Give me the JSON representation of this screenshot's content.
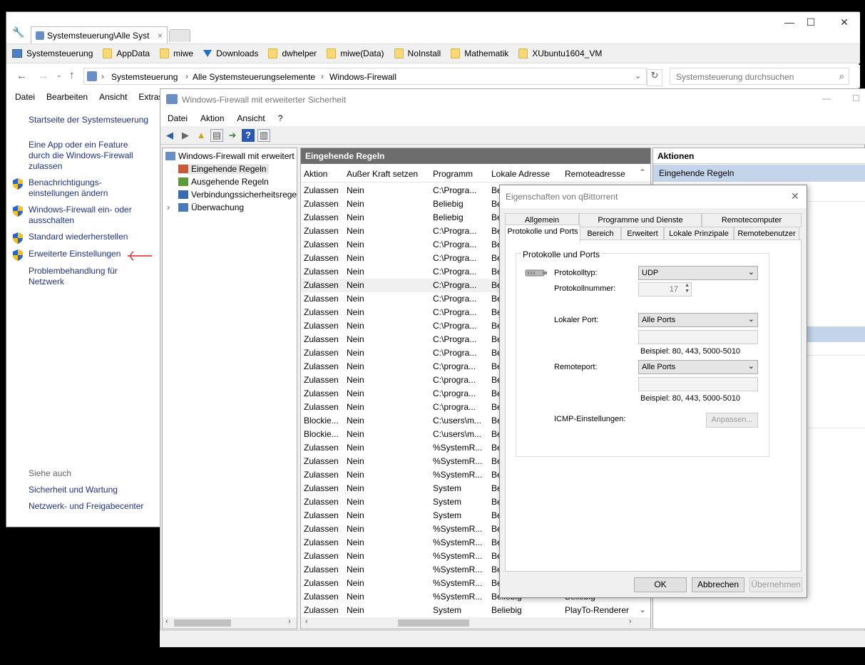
{
  "cp": {
    "tab_title": "Systemsteuerung\\Alle Syst",
    "favorites": [
      "Systemsteuerung",
      "AppData",
      "miwe",
      "Downloads",
      "dwhelper",
      "miwe(Data)",
      "NoInstall",
      "Mathematik",
      "XUbuntu1604_VM"
    ],
    "breadcrumb": [
      "Systemsteuerung",
      "Alle Systemsteuerungselemente",
      "Windows-Firewall"
    ],
    "search_placeholder": "Systemsteuerung durchsuchen",
    "menu": [
      "Datei",
      "Bearbeiten",
      "Ansicht",
      "Extras"
    ],
    "links": {
      "home": "Startseite der Systemsteuerung",
      "allow_app": "Eine App oder ein Feature durch die Windows-Firewall zulassen",
      "notify": "Benachrichtigungs-einstellungen ändern",
      "onoff": "Windows-Firewall ein- oder ausschalten",
      "restore": "Standard wiederherstellen",
      "advanced": "Erweiterte Einstellungen",
      "troubleshoot": "Problembehandlung für Netzwerk"
    },
    "see_also": "Siehe auch",
    "see_also_links": [
      "Sicherheit und Wartung",
      "Netzwerk- und Freigabecenter"
    ]
  },
  "fw": {
    "title": "Windows-Firewall mit erweiterter Sicherheit",
    "menu": [
      "Datei",
      "Aktion",
      "Ansicht",
      "?"
    ],
    "tree": {
      "root": "Windows-Firewall mit erweitert",
      "inbound": "Eingehende Regeln",
      "outbound": "Ausgehende Regeln",
      "connsec": "Verbindungssicherheitsrege",
      "monitor": "Überwachung"
    },
    "list_title": "Eingehende Regeln",
    "columns": [
      "Aktion",
      "Außer Kraft setzen",
      "Programm",
      "Lokale Adresse",
      "Remoteadresse"
    ],
    "rows": [
      [
        "Zulassen",
        "Nein",
        "C:\\Progra...",
        "Be",
        ""
      ],
      [
        "Zulassen",
        "Nein",
        "Beliebig",
        "Be",
        ""
      ],
      [
        "Zulassen",
        "Nein",
        "Beliebig",
        "Be",
        ""
      ],
      [
        "Zulassen",
        "Nein",
        "C:\\Progra...",
        "Be",
        ""
      ],
      [
        "Zulassen",
        "Nein",
        "C:\\Progra...",
        "Be",
        ""
      ],
      [
        "Zulassen",
        "Nein",
        "C:\\Progra...",
        "Be",
        ""
      ],
      [
        "Zulassen",
        "Nein",
        "C:\\Progra...",
        "Be",
        ""
      ],
      [
        "Zulassen",
        "Nein",
        "C:\\Progra...",
        "Be",
        ""
      ],
      [
        "Zulassen",
        "Nein",
        "C:\\Progra...",
        "Be",
        ""
      ],
      [
        "Zulassen",
        "Nein",
        "C:\\Progra...",
        "Be",
        ""
      ],
      [
        "Zulassen",
        "Nein",
        "C:\\Progra...",
        "Be",
        ""
      ],
      [
        "Zulassen",
        "Nein",
        "C:\\Progra...",
        "Be",
        ""
      ],
      [
        "Zulassen",
        "Nein",
        "C:\\Progra...",
        "Be",
        ""
      ],
      [
        "Zulassen",
        "Nein",
        "C:\\progra...",
        "Be",
        ""
      ],
      [
        "Zulassen",
        "Nein",
        "C:\\progra...",
        "Be",
        ""
      ],
      [
        "Zulassen",
        "Nein",
        "C:\\progra...",
        "Be",
        ""
      ],
      [
        "Zulassen",
        "Nein",
        "C:\\progra...",
        "Be",
        ""
      ],
      [
        "Blockie...",
        "Nein",
        "C:\\users\\m...",
        "Be",
        ""
      ],
      [
        "Blockie...",
        "Nein",
        "C:\\users\\m...",
        "Be",
        ""
      ],
      [
        "Zulassen",
        "Nein",
        "%SystemR...",
        "Be",
        ""
      ],
      [
        "Zulassen",
        "Nein",
        "%SystemR...",
        "Be",
        ""
      ],
      [
        "Zulassen",
        "Nein",
        "%SystemR...",
        "Be",
        ""
      ],
      [
        "Zulassen",
        "Nein",
        "System",
        "Be",
        ""
      ],
      [
        "Zulassen",
        "Nein",
        "System",
        "Be",
        ""
      ],
      [
        "Zulassen",
        "Nein",
        "System",
        "Be",
        ""
      ],
      [
        "Zulassen",
        "Nein",
        "%SystemR...",
        "Be",
        ""
      ],
      [
        "Zulassen",
        "Nein",
        "%SystemR...",
        "Be",
        ""
      ],
      [
        "Zulassen",
        "Nein",
        "%SystemR...",
        "Be",
        ""
      ],
      [
        "Zulassen",
        "Nein",
        "%SystemR...",
        "Be",
        ""
      ],
      [
        "Zulassen",
        "Nein",
        "%SystemR...",
        "Be",
        ""
      ],
      [
        "Zulassen",
        "Nein",
        "%SystemR...",
        "Beliebig",
        "Beliebig"
      ],
      [
        "Zulassen",
        "Nein",
        "System",
        "Beliebig",
        "PlayTo-Renderer"
      ]
    ],
    "actions_title": "Aktionen",
    "actions_section": "Eingehende Regeln"
  },
  "dlg": {
    "title": "Eigenschaften von qBittorrent",
    "tabs_row1": [
      "Allgemein",
      "Programme und Dienste",
      "Remotecomputer"
    ],
    "tabs_row2": [
      "Protokolle und Ports",
      "Bereich",
      "Erweitert",
      "Lokale Prinzipale",
      "Remotebenutzer"
    ],
    "group": "Protokolle und Ports",
    "proto_type_label": "Protokolltyp:",
    "proto_type_value": "UDP",
    "proto_num_label": "Protokollnummer:",
    "proto_num_value": "17",
    "local_port_label": "Lokaler Port:",
    "local_port_value": "Alle Ports",
    "local_example": "Beispiel: 80, 443, 5000-5010",
    "remote_port_label": "Remoteport:",
    "remote_port_value": "Alle Ports",
    "remote_example": "Beispiel: 80, 443, 5000-5010",
    "icmp_label": "ICMP-Einstellungen:",
    "icmp_button": "Anpassen...",
    "ok": "OK",
    "cancel": "Abbrechen",
    "apply": "Übernehmen"
  }
}
